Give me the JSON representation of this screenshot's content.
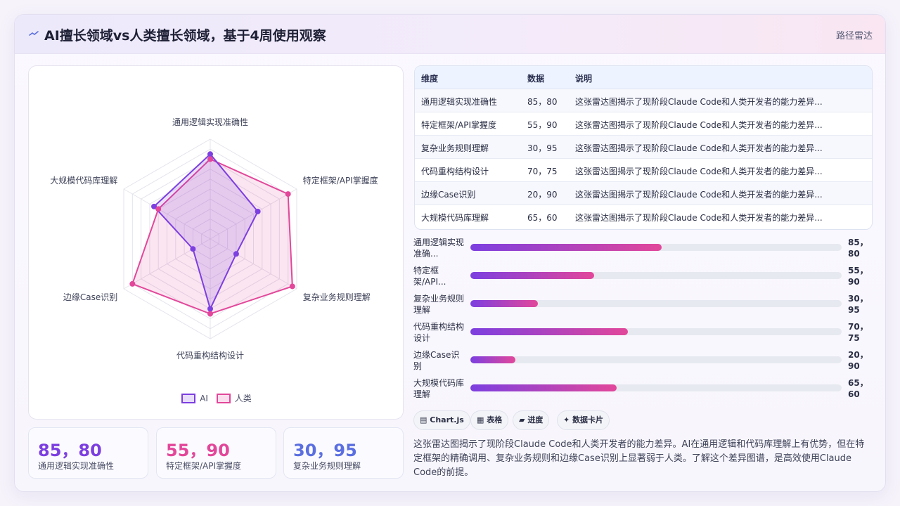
{
  "header": {
    "title": "AI擅长领域vs人类擅长领域，基于4周使用观察",
    "tag": "路径雷达",
    "icon": "sparkle-icon"
  },
  "colors": {
    "ai": "#7c3fe0",
    "human": "#e2479a",
    "accent_blue": "#5b6fe0"
  },
  "chart_data": {
    "type": "radar",
    "axes": [
      "通用逻辑实现准确性",
      "特定框架/API掌握度",
      "复杂业务规则理解",
      "代码重构结构设计",
      "边缘Case识别",
      "大规模代码库理解"
    ],
    "series": [
      {
        "name": "AI",
        "values": [
          85,
          55,
          30,
          70,
          20,
          65
        ]
      },
      {
        "name": "人类",
        "values": [
          80,
          90,
          95,
          75,
          90,
          60
        ]
      }
    ],
    "range": [
      0,
      100
    ],
    "grid_levels": 10,
    "legend": "bottom"
  },
  "legend": {
    "ai": "AI",
    "human": "人类"
  },
  "stats": [
    {
      "value": "85，80",
      "label": "通用逻辑实现准确性"
    },
    {
      "value": "55，90",
      "label": "特定框架/API掌握度"
    },
    {
      "value": "30，95",
      "label": "复杂业务规则理解"
    }
  ],
  "table": {
    "headers": [
      "维度",
      "数据",
      "说明"
    ],
    "rows": [
      [
        "通用逻辑实现准确性",
        "85，80",
        "这张雷达图揭示了现阶段Claude Code和人类开发者的能力差异..."
      ],
      [
        "特定框架/API掌握度",
        "55，90",
        "这张雷达图揭示了现阶段Claude Code和人类开发者的能力差异..."
      ],
      [
        "复杂业务规则理解",
        "30，95",
        "这张雷达图揭示了现阶段Claude Code和人类开发者的能力差异..."
      ],
      [
        "代码重构结构设计",
        "70，75",
        "这张雷达图揭示了现阶段Claude Code和人类开发者的能力差异..."
      ],
      [
        "边缘Case识别",
        "20，90",
        "这张雷达图揭示了现阶段Claude Code和人类开发者的能力差异..."
      ],
      [
        "大规模代码库理解",
        "65，60",
        "这张雷达图揭示了现阶段Claude Code和人类开发者的能力差异..."
      ]
    ]
  },
  "bars": [
    {
      "label": "通用逻辑实现准确...",
      "value": "85，80",
      "progress": 0.515
    },
    {
      "label": "特定框架/API...",
      "value": "55，90",
      "progress": 0.333
    },
    {
      "label": "复杂业务规则理解",
      "value": "30，95",
      "progress": 0.182
    },
    {
      "label": "代码重构结构设计",
      "value": "70，75",
      "progress": 0.424
    },
    {
      "label": "边缘Case识别",
      "value": "20，90",
      "progress": 0.121
    },
    {
      "label": "大规模代码库理解",
      "value": "65，60",
      "progress": 0.394
    }
  ],
  "chips": [
    {
      "icon": "chart-icon",
      "glyph": "▤",
      "label": "Chart.js"
    },
    {
      "icon": "table-icon",
      "glyph": "▦",
      "label": "表格"
    },
    {
      "icon": "progress-icon",
      "glyph": "▰",
      "label": "进度"
    },
    {
      "icon": "card-icon",
      "glyph": "✦",
      "label": "数据卡片"
    }
  ],
  "summary": "这张雷达图揭示了现阶段Claude Code和人类开发者的能力差异。AI在通用逻辑和代码库理解上有优势，但在特定框架的精确调用、复杂业务规则和边缘Case识别上显著弱于人类。了解这个差异图谱，是高效使用Claude Code的前提。"
}
